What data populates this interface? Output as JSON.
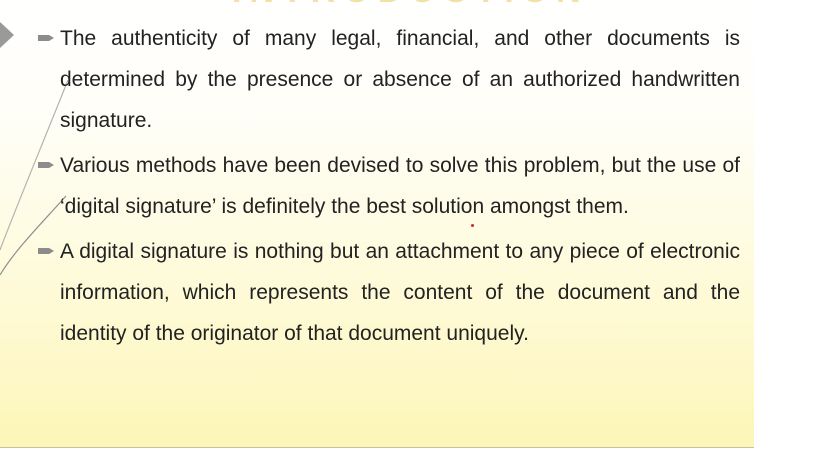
{
  "slide": {
    "title_fragment": "INTRODUCTION",
    "bullets": [
      {
        "text": "The authenticity of many legal, financial, and other documents is determined by the presence or absence of an authorized handwritten signature."
      },
      {
        "text": "Various methods have been devised to solve this problem, but the use of ‘digital signature’ is definitely the best solution amongst them."
      },
      {
        "text": "A digital signature is nothing but an attachment to any piece of electronic information, which represents the content of the document and the identity of the originator of that document uniquely."
      }
    ]
  },
  "colors": {
    "text": "#222222",
    "bullet_marker": "#8c8c8c",
    "background_top": "#ffffff",
    "background_bottom": "#fdf6b8",
    "title_fragment": "#f1e2a2",
    "decor_line": "#a8a8a8",
    "nav_arrow": "#999999"
  },
  "icons": {
    "bullet": "pencil-bullet-icon",
    "nav": "slide-nav-arrow-icon"
  }
}
